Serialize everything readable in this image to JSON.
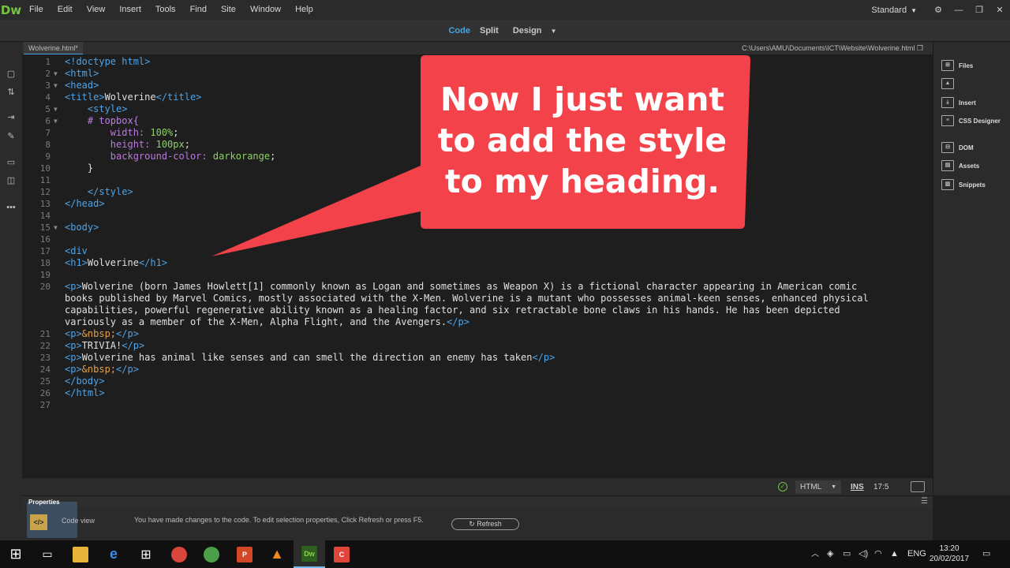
{
  "app": {
    "logo": "Dw",
    "menu": [
      "File",
      "Edit",
      "View",
      "Insert",
      "Tools",
      "Find",
      "Site",
      "Window",
      "Help"
    ],
    "workspace": "Standard",
    "gear_icon": "gear-icon"
  },
  "viewbar": {
    "code": "Code",
    "split": "Split",
    "design": "Design"
  },
  "document": {
    "tab": "Wolverine.html*",
    "path": "C:\\Users\\AMU\\Documents\\ICT\\Website\\Wolverine.html"
  },
  "code_lines": [
    {
      "n": "1",
      "fold": false,
      "tokens": [
        [
          "tag",
          "<!doctype html>"
        ]
      ]
    },
    {
      "n": "2",
      "fold": true,
      "tokens": [
        [
          "tag",
          "<html>"
        ]
      ]
    },
    {
      "n": "3",
      "fold": true,
      "tokens": [
        [
          "tag",
          "<head>"
        ]
      ]
    },
    {
      "n": "4",
      "fold": false,
      "tokens": [
        [
          "tag",
          "<title>"
        ],
        [
          "txt",
          "Wolverine"
        ],
        [
          "tag",
          "</title>"
        ]
      ]
    },
    {
      "n": "5",
      "fold": true,
      "tokens": [
        [
          "txt",
          "    "
        ],
        [
          "tag",
          "<style>"
        ]
      ]
    },
    {
      "n": "6",
      "fold": true,
      "tokens": [
        [
          "txt",
          "    "
        ],
        [
          "sel",
          "# topbox{"
        ]
      ]
    },
    {
      "n": "7",
      "fold": false,
      "tokens": [
        [
          "txt",
          "        "
        ],
        [
          "prop",
          "width: "
        ],
        [
          "val",
          "100%"
        ],
        [
          "txt",
          ";"
        ]
      ]
    },
    {
      "n": "8",
      "fold": false,
      "tokens": [
        [
          "txt",
          "        "
        ],
        [
          "prop",
          "height: "
        ],
        [
          "val",
          "100px"
        ],
        [
          "txt",
          ";"
        ]
      ]
    },
    {
      "n": "9",
      "fold": false,
      "tokens": [
        [
          "txt",
          "        "
        ],
        [
          "prop",
          "background-color: "
        ],
        [
          "val",
          "darkorange"
        ],
        [
          "txt",
          ";"
        ]
      ]
    },
    {
      "n": "10",
      "fold": false,
      "tokens": [
        [
          "txt",
          "    }"
        ]
      ]
    },
    {
      "n": "11",
      "fold": false,
      "tokens": []
    },
    {
      "n": "12",
      "fold": false,
      "tokens": [
        [
          "txt",
          "    "
        ],
        [
          "tag",
          "</style>"
        ]
      ]
    },
    {
      "n": "13",
      "fold": false,
      "tokens": [
        [
          "tag",
          "</head>"
        ]
      ]
    },
    {
      "n": "14",
      "fold": false,
      "tokens": []
    },
    {
      "n": "15",
      "fold": true,
      "tokens": [
        [
          "tag",
          "<body>"
        ]
      ]
    },
    {
      "n": "16",
      "fold": false,
      "tokens": []
    },
    {
      "n": "17",
      "fold": false,
      "tokens": [
        [
          "tag",
          "<div"
        ]
      ]
    },
    {
      "n": "18",
      "fold": false,
      "tokens": [
        [
          "tag",
          "<h1>"
        ],
        [
          "txt",
          "Wolverine"
        ],
        [
          "tag",
          "</h1>"
        ]
      ]
    },
    {
      "n": "19",
      "fold": false,
      "tokens": []
    },
    {
      "n": "20",
      "fold": false,
      "tokens": [
        [
          "tag",
          "<p>"
        ],
        [
          "txt",
          "Wolverine (born James Howlett[1] commonly known as Logan and sometimes as Weapon X) is a fictional character appearing in American comic"
        ]
      ]
    },
    {
      "n": "",
      "fold": false,
      "tokens": [
        [
          "txt",
          "books published by Marvel Comics, mostly associated with the X-Men. Wolverine is a mutant who possesses animal-keen senses, enhanced physical"
        ]
      ]
    },
    {
      "n": "",
      "fold": false,
      "tokens": [
        [
          "txt",
          "capabilities, powerful regenerative ability known as a healing factor, and six retractable bone claws in his hands. He has been depicted"
        ]
      ]
    },
    {
      "n": "",
      "fold": false,
      "tokens": [
        [
          "txt",
          "variously as a member of the X-Men, Alpha Flight, and the Avengers."
        ],
        [
          "tag",
          "</p>"
        ]
      ]
    },
    {
      "n": "21",
      "fold": false,
      "tokens": [
        [
          "tag",
          "<p>"
        ],
        [
          "ent",
          "&nbsp;"
        ],
        [
          "tag",
          "</p>"
        ]
      ]
    },
    {
      "n": "22",
      "fold": false,
      "tokens": [
        [
          "tag",
          "<p>"
        ],
        [
          "txt",
          "TRIVIA!"
        ],
        [
          "tag",
          "</p>"
        ]
      ]
    },
    {
      "n": "23",
      "fold": false,
      "tokens": [
        [
          "tag",
          "<p>"
        ],
        [
          "txt",
          "Wolverine has animal like senses and can smell the direction an enemy has taken"
        ],
        [
          "tag",
          "</p>"
        ]
      ]
    },
    {
      "n": "24",
      "fold": false,
      "tokens": [
        [
          "tag",
          "<p>"
        ],
        [
          "ent",
          "&nbsp;"
        ],
        [
          "tag",
          "</p>"
        ]
      ]
    },
    {
      "n": "25",
      "fold": false,
      "tokens": [
        [
          "tag",
          "</body>"
        ]
      ]
    },
    {
      "n": "26",
      "fold": false,
      "tokens": [
        [
          "tag",
          "</html>"
        ]
      ]
    },
    {
      "n": "27",
      "fold": false,
      "tokens": []
    }
  ],
  "callout": {
    "lines": [
      "Now I just want",
      "to add the style",
      "to my heading."
    ],
    "color": "#f4424a"
  },
  "status": {
    "language": "HTML",
    "ins": "INS",
    "position": "17:5"
  },
  "right_panel": [
    "Files",
    "",
    "Insert",
    "CSS Designer",
    "DOM",
    "Assets",
    "Snippets"
  ],
  "properties": {
    "title": "Properties",
    "code_view": "Code view",
    "message": "You have made changes to the code. To edit selection properties, Click Refresh or press F5.",
    "refresh": "Refresh"
  },
  "taskbar": {
    "tray_lang": "ENG",
    "time": "13:20",
    "date": "20/02/2017",
    "apps": [
      "start",
      "task-view",
      "file-explorer",
      "edge",
      "store",
      "chrome-user",
      "chrome",
      "powerpoint",
      "vlc",
      "dreamweaver",
      "camtasia"
    ]
  }
}
